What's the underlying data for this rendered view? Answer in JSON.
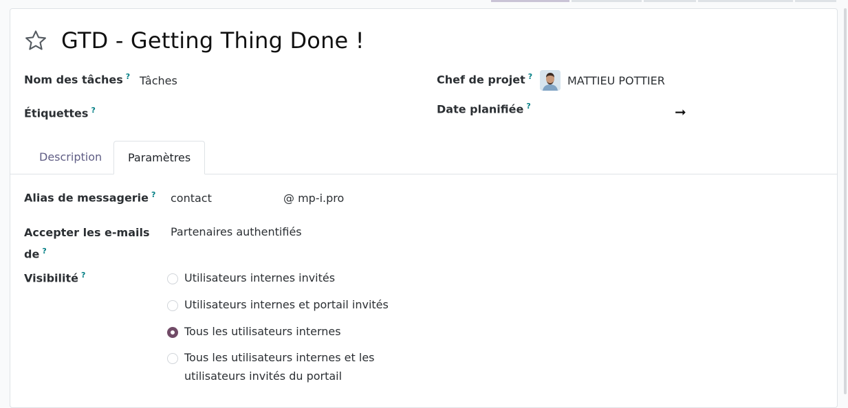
{
  "project": {
    "title": "GTD - Getting Thing Done !"
  },
  "help_mark": "?",
  "fields": {
    "task_name_label": "Nom des tâches",
    "task_name_value": "Tâches",
    "tags_label": "Étiquettes",
    "manager_label": "Chef de projet",
    "manager_value": "MATTIEU POTTIER",
    "date_label": "Date planifiée",
    "date_arrow": "➞"
  },
  "tabs": [
    {
      "label": "Description",
      "active": false
    },
    {
      "label": "Paramètres",
      "active": true
    }
  ],
  "settings": {
    "alias_label": "Alias de messagerie",
    "alias_value": "contact",
    "alias_domain": "@ mp-i.pro",
    "accept_label_line1": "Accepter les e-mails",
    "accept_label_line2": "de",
    "accept_value": "Partenaires authentifiés",
    "visibility_label": "Visibilité",
    "visibility_options": [
      {
        "label": "Utilisateurs internes invités",
        "checked": false
      },
      {
        "label": "Utilisateurs internes et portail invités",
        "checked": false
      },
      {
        "label": "Tous les utilisateurs internes",
        "checked": true
      },
      {
        "label_line1": "Tous les utilisateurs internes et les",
        "label_line2": "utilisateurs invités du portail",
        "checked": false
      }
    ]
  },
  "colors": {
    "accent": "#714b67",
    "help": "#017e84",
    "tab_inactive": "#5f5d84"
  },
  "icons": {
    "favorite": "star-icon",
    "date_range": "arrow-right-icon",
    "manager": "avatar"
  }
}
